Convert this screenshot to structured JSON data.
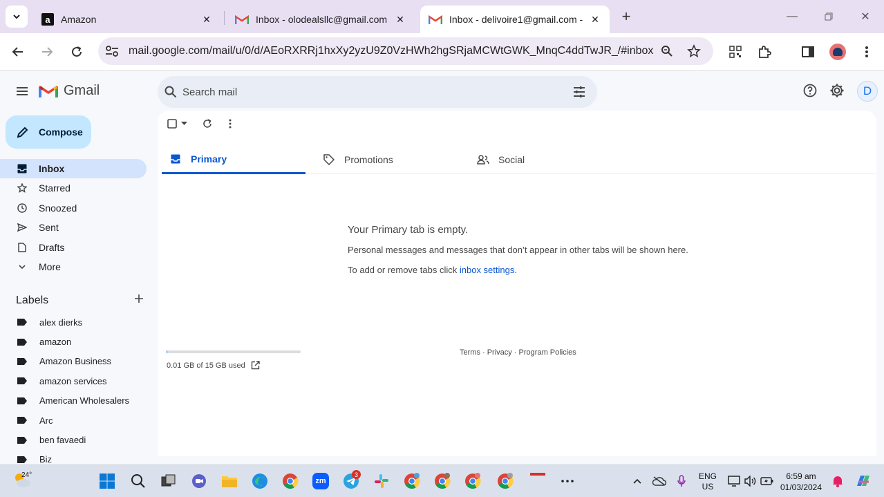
{
  "browser": {
    "tabs": [
      {
        "title": "Amazon",
        "active": false
      },
      {
        "title": "Inbox - olodealsllc@gmail.com",
        "active": false
      },
      {
        "title": "Inbox - delivoire1@gmail.com -",
        "active": true
      }
    ],
    "url": "mail.google.com/mail/u/0/d/AEoRXRRj1hxXy2yzU9Z0VzHWh2hgSRjaMCWtGWK_MnqC4ddTwJR_/#inbox"
  },
  "gmail": {
    "brand": "Gmail",
    "search_placeholder": "Search mail",
    "avatar_letter": "D",
    "compose_label": "Compose",
    "nav": [
      {
        "label": "Inbox",
        "icon": "inbox-icon",
        "active": true
      },
      {
        "label": "Starred",
        "icon": "star-icon",
        "active": false
      },
      {
        "label": "Snoozed",
        "icon": "clock-icon",
        "active": false
      },
      {
        "label": "Sent",
        "icon": "send-icon",
        "active": false
      },
      {
        "label": "Drafts",
        "icon": "draft-icon",
        "active": false
      },
      {
        "label": "More",
        "icon": "chevron-down-icon",
        "active": false
      }
    ],
    "labels_heading": "Labels",
    "labels": [
      "alex dierks",
      "amazon",
      "Amazon Business",
      "amazon services",
      "American Wholesalers",
      "Arc",
      "ben favaedi",
      "Biz"
    ],
    "tabs": [
      {
        "label": "Primary",
        "icon": "inbox-tab-icon",
        "active": true
      },
      {
        "label": "Promotions",
        "icon": "tag-icon",
        "active": false
      },
      {
        "label": "Social",
        "icon": "people-icon",
        "active": false
      }
    ],
    "empty": {
      "heading": "Your Primary tab is empty.",
      "line1": "Personal messages and messages that don’t appear in other tabs will be shown here.",
      "line2_prefix": "To add or remove tabs click ",
      "line2_link": "inbox settings",
      "line2_suffix": "."
    },
    "storage": {
      "text": "0.01 GB of 15 GB used",
      "used_fraction": 0.001
    },
    "footer": "Terms · Privacy · Program Policies"
  },
  "taskbar": {
    "weather": "24°",
    "telegram_badge": "3",
    "language": "ENG",
    "region": "US",
    "time": "6:59 am",
    "date": "01/03/2024"
  },
  "colors": {
    "accent": "#0b57d0",
    "compose": "#c2e7ff",
    "active_nav": "#d3e3fd"
  }
}
